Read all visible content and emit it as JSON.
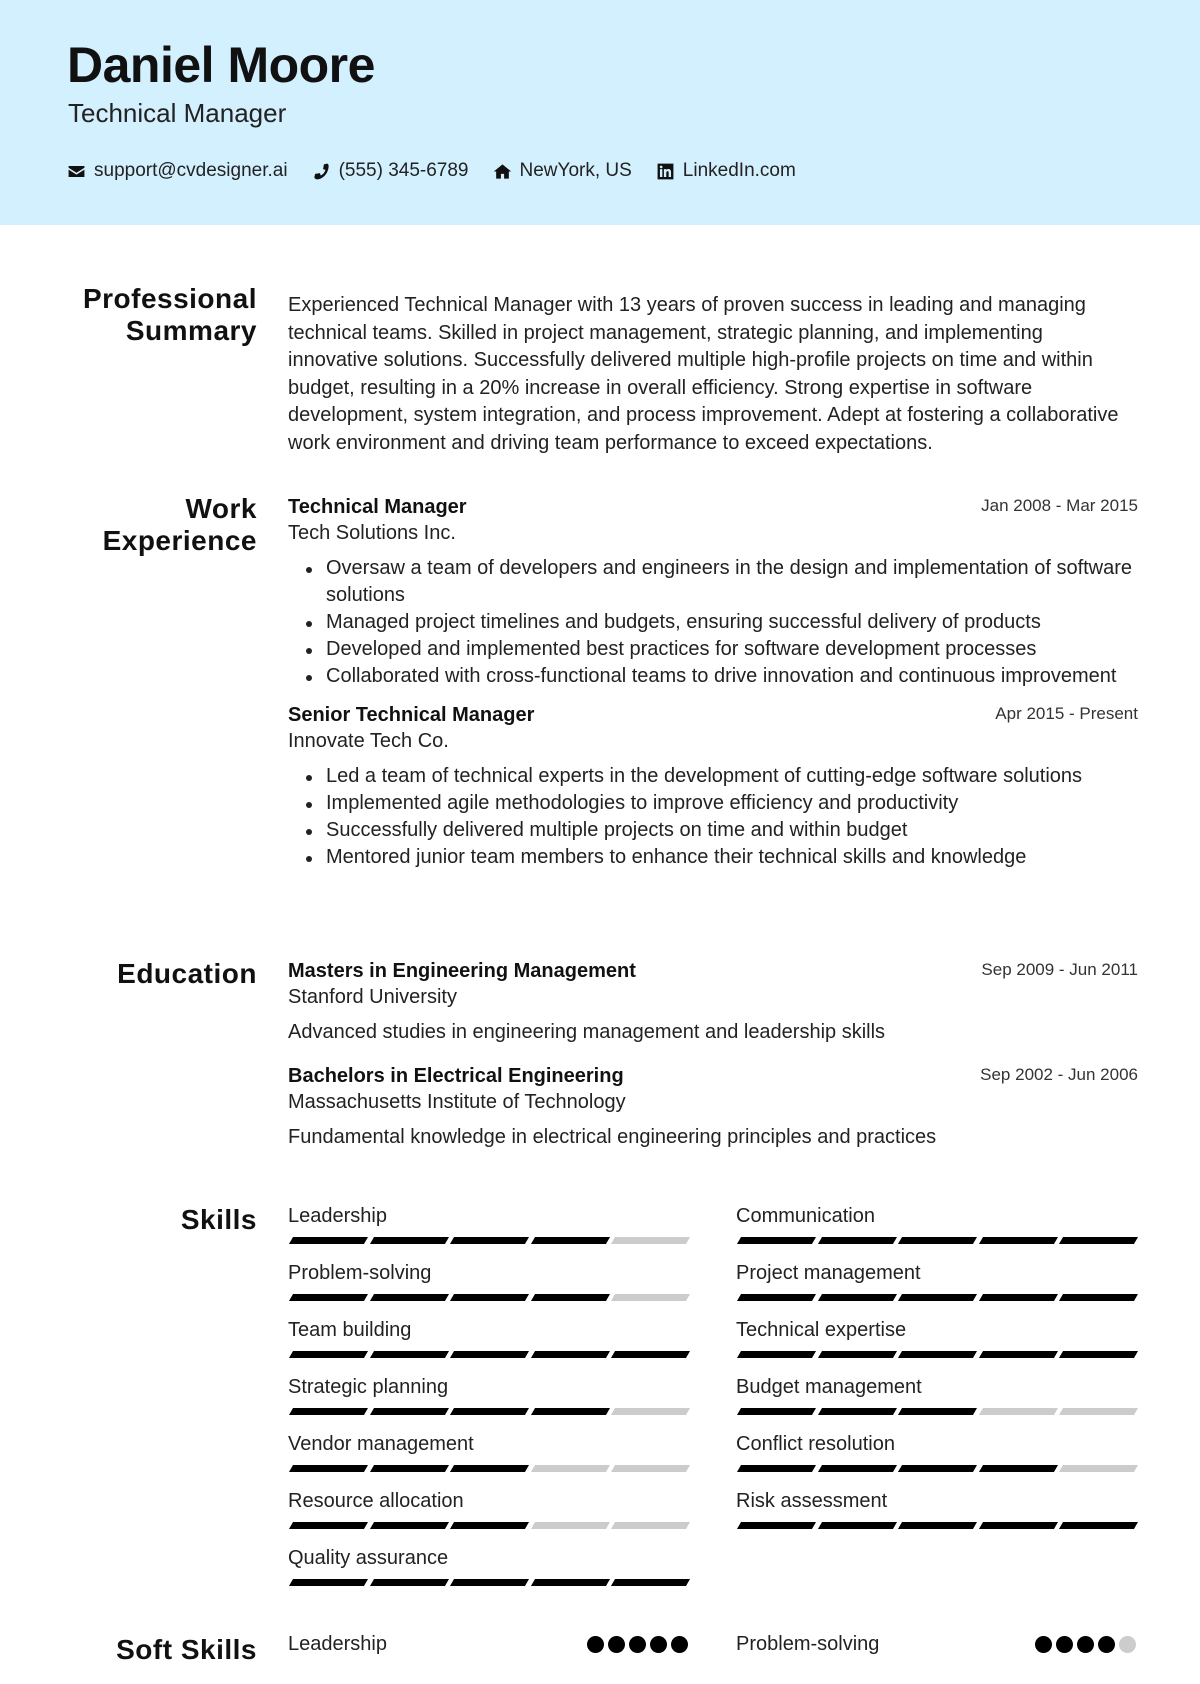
{
  "header": {
    "name": "Daniel Moore",
    "title": "Technical Manager",
    "contacts": [
      {
        "icon": "envelope-icon",
        "text": "support@cvdesigner.ai"
      },
      {
        "icon": "phone-icon",
        "text": "(555) 345-6789"
      },
      {
        "icon": "home-icon",
        "text": "NewYork, US"
      },
      {
        "icon": "linkedin-icon",
        "text": "LinkedIn.com"
      }
    ],
    "background_color": "#d3f0ff"
  },
  "sections": {
    "summary_title": "Professional Summary",
    "work_title": "Work Experience",
    "education_title": "Education",
    "skills_title": "Skills",
    "soft_skills_title": "Soft Skills"
  },
  "summary": "Experienced Technical Manager with 13 years of proven success in leading and managing technical teams. Skilled in project management, strategic planning, and implementing innovative solutions. Successfully delivered multiple high-profile projects on time and within budget, resulting in a 20% increase in overall efficiency. Strong expertise in software development, system integration, and process improvement. Adept at fostering a collaborative work environment and driving team performance to exceed expectations.",
  "experience": [
    {
      "title": "Technical Manager",
      "company": "Tech Solutions Inc.",
      "dates": "Jan 2008 - Mar 2015",
      "bullets": [
        "Oversaw a team of developers and engineers in the design and implementation of software solutions",
        "Managed project timelines and budgets, ensuring successful delivery of products",
        "Developed and implemented best practices for software development processes",
        "Collaborated with cross-functional teams to drive innovation and continuous improvement"
      ]
    },
    {
      "title": "Senior Technical Manager",
      "company": "Innovate Tech Co.",
      "dates": "Apr 2015 - Present",
      "bullets": [
        "Led a team of technical experts in the development of cutting-edge software solutions",
        "Implemented agile methodologies to improve efficiency and productivity",
        "Successfully delivered multiple projects on time and within budget",
        "Mentored junior team members to enhance their technical skills and knowledge"
      ]
    }
  ],
  "education": [
    {
      "degree": "Masters in Engineering Management",
      "school": "Stanford University",
      "dates": "Sep 2009 - Jun 2011",
      "description": "Advanced studies in engineering management and leadership skills"
    },
    {
      "degree": "Bachelors in Electrical Engineering",
      "school": "Massachusetts Institute of Technology",
      "dates": "Sep 2002 - Jun 2006",
      "description": "Fundamental knowledge in electrical engineering principles and practices"
    }
  ],
  "skills": [
    {
      "name": "Leadership",
      "level": 4,
      "max": 5
    },
    {
      "name": "Communication",
      "level": 5,
      "max": 5
    },
    {
      "name": "Problem-solving",
      "level": 4,
      "max": 5
    },
    {
      "name": "Project management",
      "level": 5,
      "max": 5
    },
    {
      "name": "Team building",
      "level": 5,
      "max": 5
    },
    {
      "name": "Technical expertise",
      "level": 5,
      "max": 5
    },
    {
      "name": "Strategic planning",
      "level": 4,
      "max": 5
    },
    {
      "name": "Budget management",
      "level": 3,
      "max": 5
    },
    {
      "name": "Vendor management",
      "level": 3,
      "max": 5
    },
    {
      "name": "Conflict resolution",
      "level": 4,
      "max": 5
    },
    {
      "name": "Resource allocation",
      "level": 3,
      "max": 5
    },
    {
      "name": "Risk assessment",
      "level": 5,
      "max": 5
    },
    {
      "name": "Quality assurance",
      "level": 5,
      "max": 5
    }
  ],
  "soft_skills": [
    {
      "name": "Leadership",
      "level": 5,
      "max": 5
    },
    {
      "name": "Problem-solving",
      "level": 4,
      "max": 5
    }
  ]
}
